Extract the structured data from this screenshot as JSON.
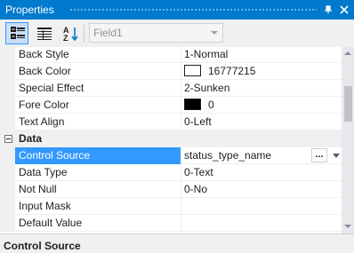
{
  "window": {
    "title": "Properties",
    "pin_glyph": "⫏",
    "close_glyph": "✕"
  },
  "toolbar": {
    "object_selector": "Field1",
    "buttons": [
      "categorized-icon",
      "property-pages-icon",
      "alphabetical-icon"
    ]
  },
  "properties_top": [
    {
      "name": "Back Style",
      "value": "1-Normal"
    },
    {
      "name": "Back Color",
      "value": "16777215",
      "swatch": "#ffffff"
    },
    {
      "name": "Special Effect",
      "value": "2-Sunken"
    },
    {
      "name": "Fore Color",
      "value": "0",
      "swatch": "#000000"
    },
    {
      "name": "Text Align",
      "value": "0-Left"
    }
  ],
  "category": {
    "label": "Data"
  },
  "properties_data": [
    {
      "name": "Control Source",
      "value": "status_type_name",
      "selected": true
    },
    {
      "name": "Data Type",
      "value": "0-Text"
    },
    {
      "name": "Not Null",
      "value": "0-No"
    },
    {
      "name": "Input Mask",
      "value": ""
    },
    {
      "name": "Default Value",
      "value": ""
    }
  ],
  "ellipsis_label": "...",
  "description": {
    "title": "Control Source"
  },
  "colors": {
    "titlebar": "#007acc",
    "selection": "#3399ff"
  }
}
